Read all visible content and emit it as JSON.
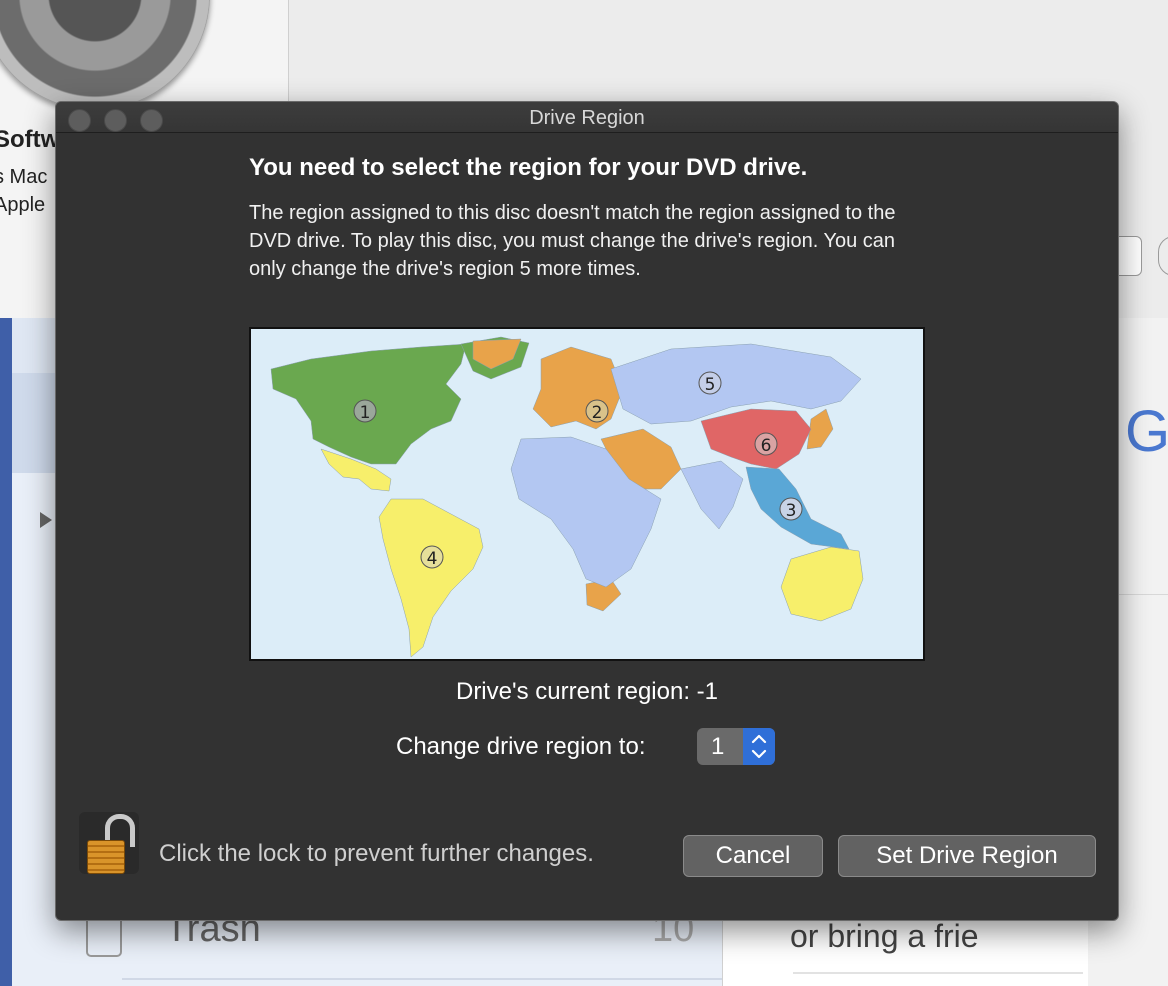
{
  "background": {
    "system_prefs_partial_title": "Softw",
    "system_prefs_partial_line1": "s Mac",
    "system_prefs_partial_line2": "Apple",
    "mail_trash_label": "Trash",
    "mail_trash_count": "10",
    "content_letter": "G",
    "content_snippet": "or bring a frie"
  },
  "dialog": {
    "title": "Drive Region",
    "heading": "You need to select the region for your DVD drive.",
    "message": "The region assigned to this disc doesn't match the region assigned to the DVD drive. To play this disc, you must change the drive's region. You can only change the drive's region 5 more times.",
    "map": {
      "region_markers": [
        "1",
        "2",
        "3",
        "4",
        "5",
        "6"
      ],
      "region_colors": {
        "1": "#6aa84f",
        "2": "#e8a34a",
        "3": "#5aa7d6",
        "4": "#f7ef6b",
        "5": "#b3c7f2",
        "6": "#e06666"
      }
    },
    "current_region": "Drive's current region: -1",
    "change_label": "Change drive region to:",
    "stepper_value": "1",
    "lock_text": "Click the lock to prevent further changes.",
    "cancel_label": "Cancel",
    "set_label": "Set Drive Region"
  },
  "colors": {
    "dialog_bg": "#323232",
    "accent": "#2f6fd8"
  }
}
